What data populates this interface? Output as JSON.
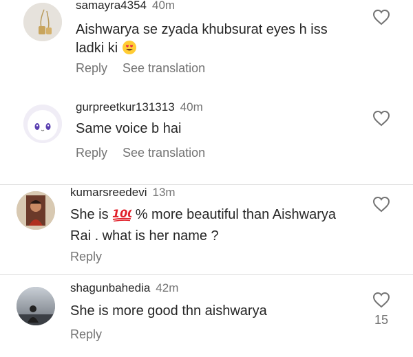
{
  "comments": [
    {
      "username": "samayra4354",
      "time": "40m",
      "text_a": "Aishwarya se zyada khubsurat eyes h iss",
      "text_b": "ladki ki",
      "emoji": "heart-eyes-emoji",
      "reply_label": "Reply",
      "translate_label": "See translation"
    },
    {
      "username": "gurpreetkur131313",
      "time": "40m",
      "text": "Same voice b hai",
      "reply_label": "Reply",
      "translate_label": "See translation"
    },
    {
      "username": "kumarsreedevi",
      "time": "13m",
      "text_a_before": "She is ",
      "emoji": "hundred-points-emoji",
      "text_a_after": " %  more beautiful than Aishwarya",
      "text_b": "Rai . what is her name ?",
      "reply_label": "Reply"
    },
    {
      "username": "shagunbahedia",
      "time": "42m",
      "text": "She is more good thn aishwarya",
      "reply_label": "Reply",
      "like_count": "15"
    }
  ],
  "colors": {
    "text": "#262626",
    "secondary": "#737373",
    "divider": "#dbdbdb"
  }
}
